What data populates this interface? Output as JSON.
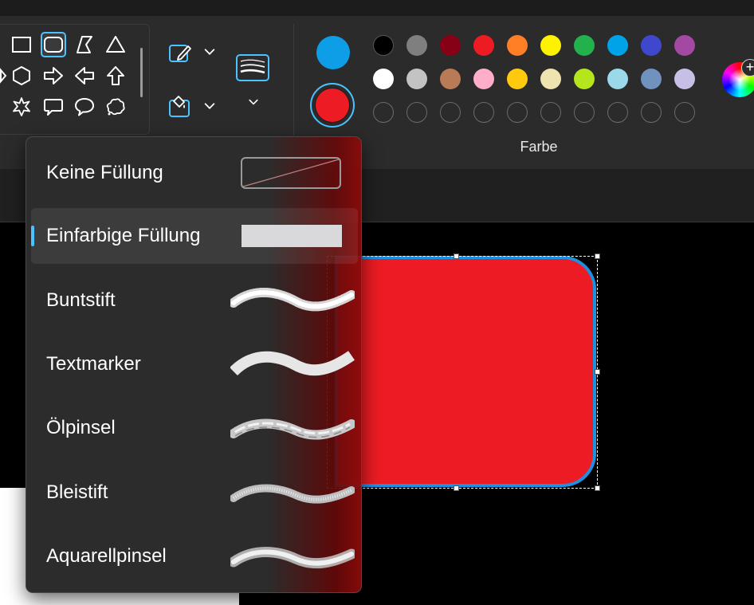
{
  "ribbon": {
    "shapes": [
      {
        "name": "rectangle-icon",
        "selected": false
      },
      {
        "name": "rounded-rectangle-icon",
        "selected": true
      },
      {
        "name": "polygon-icon",
        "selected": false
      },
      {
        "name": "triangle-icon",
        "selected": false
      },
      {
        "name": "hexagon-icon",
        "selected": false
      },
      {
        "name": "arrow-right-icon",
        "selected": false
      },
      {
        "name": "arrow-left-icon",
        "selected": false
      },
      {
        "name": "arrow-up-icon",
        "selected": false
      },
      {
        "name": "star-icon",
        "selected": false
      },
      {
        "name": "speech-bubble-rect-icon",
        "selected": false
      },
      {
        "name": "speech-bubble-oval-icon",
        "selected": false
      },
      {
        "name": "speech-bubble-cloud-icon",
        "selected": false
      }
    ],
    "tools": {
      "outline_icon": "pencil-outline-icon",
      "fill_icon": "paint-bucket-icon",
      "brush_size_icon": "brush-size-icon"
    },
    "colors": {
      "primary": "#0e9ee8",
      "secondary": "#ed1c24",
      "palette_row1": [
        "#000000",
        "#7f7f7f",
        "#880015",
        "#ed1c24",
        "#ff7f27",
        "#fff200",
        "#22b14c",
        "#00a2e8",
        "#3f48cc",
        "#a349a4"
      ],
      "palette_row2": [
        "#ffffff",
        "#c3c3c3",
        "#b97a57",
        "#ffaec9",
        "#ffc90e",
        "#efe4b0",
        "#b5e61d",
        "#99d9ea",
        "#7092be",
        "#c8bfe7"
      ],
      "custom_slots": 10,
      "label": "Farbe"
    }
  },
  "fill_menu": {
    "items": [
      {
        "label": "Keine Füllung",
        "preview": "none",
        "selected": false
      },
      {
        "label": "Einfarbige Füllung",
        "preview": "solid",
        "selected": true
      },
      {
        "label": "Buntstift",
        "preview": "crayon",
        "selected": false
      },
      {
        "label": "Textmarker",
        "preview": "marker",
        "selected": false
      },
      {
        "label": "Ölpinsel",
        "preview": "oil",
        "selected": false
      },
      {
        "label": "Bleistift",
        "preview": "pencil",
        "selected": false
      },
      {
        "label": "Aquarellpinsel",
        "preview": "watercolor",
        "selected": false
      }
    ]
  },
  "canvas": {
    "shape_fill": "#ed1c24",
    "shape_outline": "#1e90e0"
  }
}
